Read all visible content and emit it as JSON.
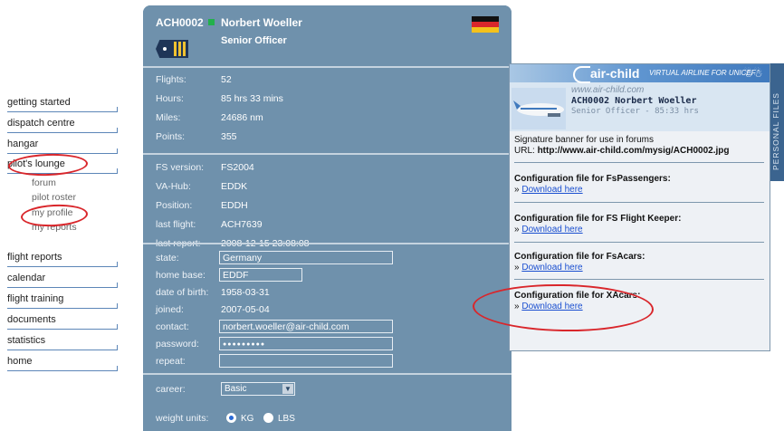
{
  "nav": {
    "items": [
      {
        "label": "getting started"
      },
      {
        "label": "dispatch centre"
      },
      {
        "label": "hangar"
      },
      {
        "label": "pilot's lounge"
      },
      {
        "label": "flight reports"
      },
      {
        "label": "calendar"
      },
      {
        "label": "flight training"
      },
      {
        "label": "documents"
      },
      {
        "label": "statistics"
      },
      {
        "label": "home"
      }
    ],
    "lounge_sub": [
      "forum",
      "pilot roster",
      "my profile",
      "my reports"
    ]
  },
  "profile": {
    "id": "ACH0002",
    "name": "Norbert Woeller",
    "rank": "Senior Officer",
    "stats": [
      {
        "key": "Flights:",
        "value": "52"
      },
      {
        "key": "Hours:",
        "value": "85 hrs 33 mins"
      },
      {
        "key": "Miles:",
        "value": "24686 nm"
      },
      {
        "key": "Points:",
        "value": "355"
      }
    ],
    "sim": [
      {
        "key": "FS version:",
        "value": "FS2004"
      },
      {
        "key": "VA-Hub:",
        "value": "EDDK"
      },
      {
        "key": "Position:",
        "value": "EDDH"
      },
      {
        "key": "last flight:",
        "value": "ACH7639"
      },
      {
        "key": "last report:",
        "value": "2008-12-15 23:08:08"
      }
    ],
    "fields": {
      "state_label": "state:",
      "state_value": "Germany",
      "homebase_label": "home base:",
      "homebase_value": "EDDF",
      "dob_label": "date of birth:",
      "dob_value": "1958-03-31",
      "joined_label": "joined:",
      "joined_value": "2007-05-04",
      "contact_label": "contact:",
      "contact_value": "norbert.woeller@air-child.com",
      "password_label": "password:",
      "password_value": "●●●●●●●●●",
      "repeat_label": "repeat:",
      "repeat_value": ""
    },
    "career_label": "career:",
    "career_value": "Basic",
    "weight_label": "weight units:",
    "weight_options": [
      "KG",
      "LBS"
    ],
    "weight_selected": "KG"
  },
  "signature": {
    "brand": "air-child",
    "tagline": "VIRTUAL AIRLINE FOR UNICEF",
    "url": "www.air-child.com",
    "banner_name": "ACH0002 Norbert Woeller",
    "banner_rank": "Senior Officer - 85:33 hrs",
    "info_line": "Signature banner for use in forums",
    "info_url_label": "URL:",
    "info_url": "http://www.air-child.com/mysig/ACH0002.jpg",
    "configs": [
      {
        "title": "Configuration file for FsPassengers:",
        "link": "Download here"
      },
      {
        "title": "Configuration file for FS Flight Keeper:",
        "link": "Download here"
      },
      {
        "title": "Configuration file for FsAcars:",
        "link": "Download here"
      },
      {
        "title": "Configuration file for XAcars:",
        "link": "Download here"
      }
    ],
    "side_tab": "PERSONAL FILES"
  },
  "colors": {
    "panel": "#6f91ac",
    "accent_red": "#d9262b",
    "link": "#1a4fd0"
  }
}
